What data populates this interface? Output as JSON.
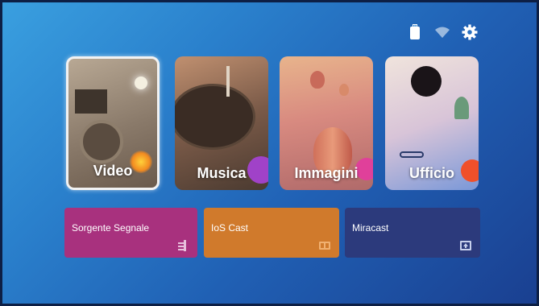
{
  "status_icons": [
    "usb-drive-icon",
    "wifi-icon",
    "settings-gear-icon"
  ],
  "tiles": [
    {
      "label": "Video"
    },
    {
      "label": "Musica"
    },
    {
      "label": "Immagini"
    },
    {
      "label": "Ufficio"
    }
  ],
  "sources": [
    {
      "label": "Sorgente Segnale",
      "icon": "signal-source-icon",
      "color": "#a8317e"
    },
    {
      "label": "IoS Cast",
      "icon": "ios-cast-icon",
      "color": "#d07a2c"
    },
    {
      "label": "Miracast",
      "icon": "miracast-icon",
      "color": "#2c3a7c"
    }
  ],
  "colors": {
    "background": "#2a80cc",
    "selected_border": "#f2f2f2"
  }
}
